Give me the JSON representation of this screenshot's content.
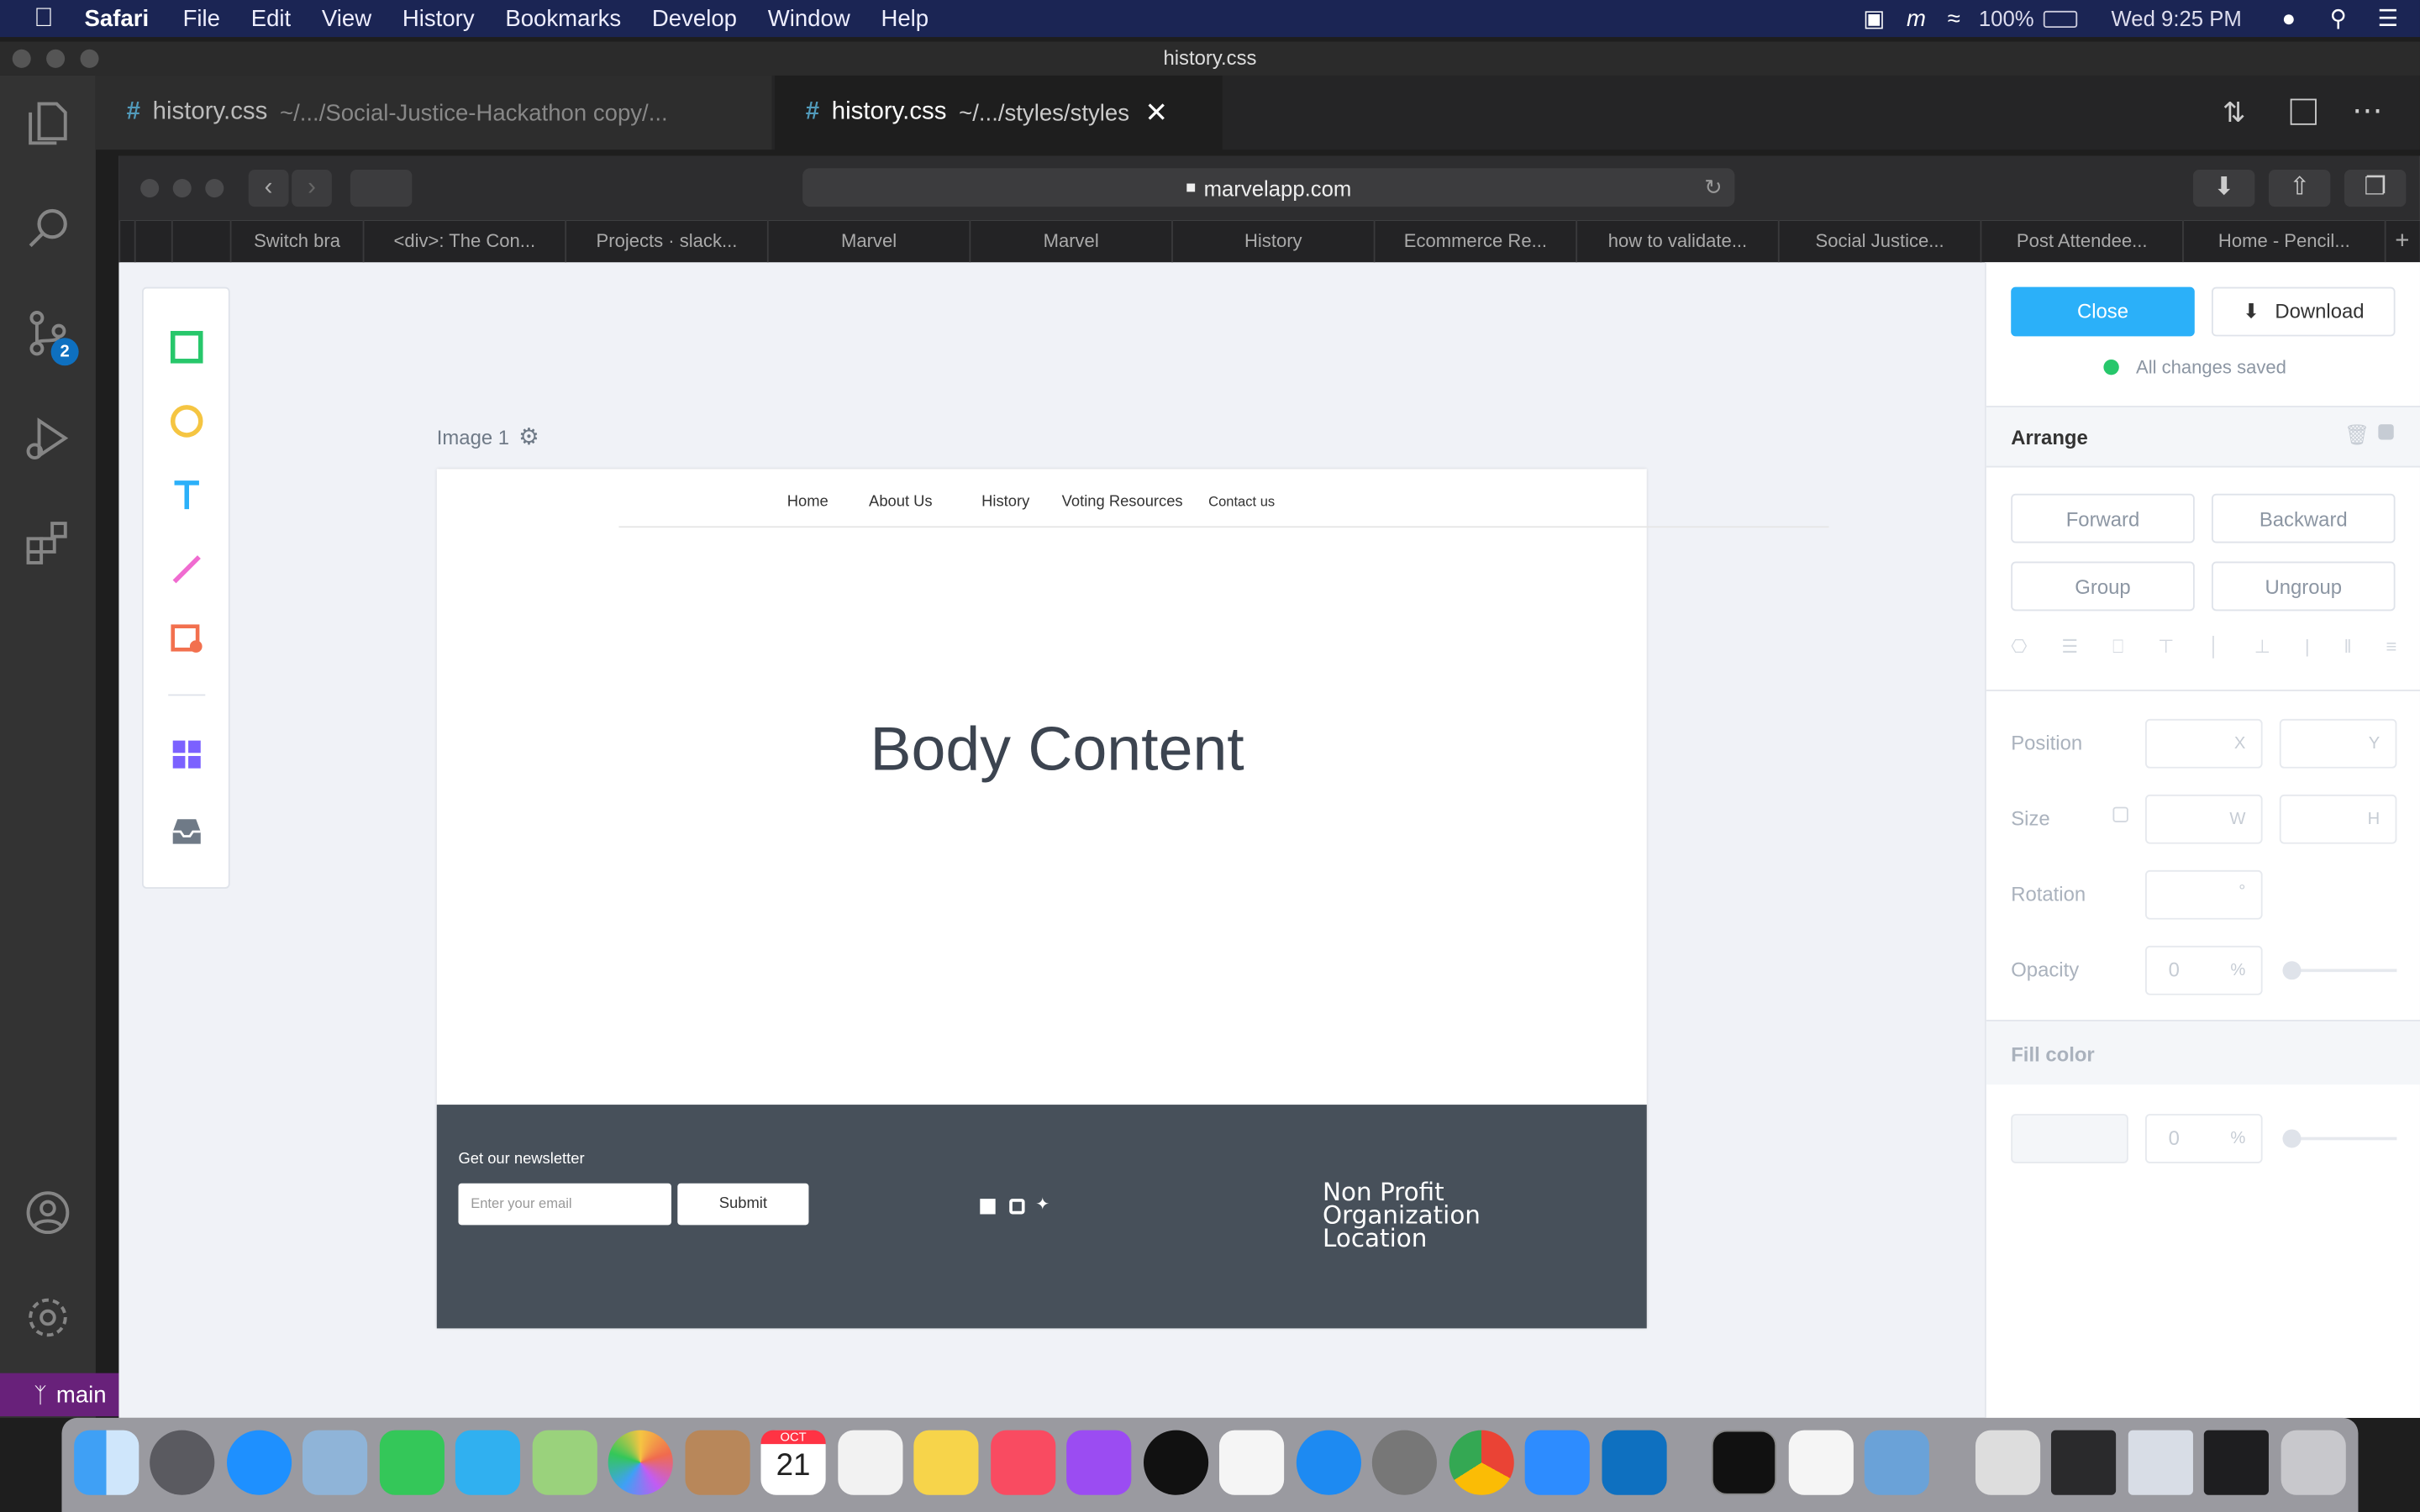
{
  "menubar": {
    "app": "Safari",
    "items": [
      "File",
      "Edit",
      "View",
      "History",
      "Bookmarks",
      "Develop",
      "Window",
      "Help"
    ],
    "battery": "100%",
    "clock": "Wed 9:25 PM"
  },
  "window": {
    "title": "history.css"
  },
  "editor_tabs": [
    {
      "name": "history.css",
      "path": "~/.../Social-Justice-Hackathon copy/..."
    },
    {
      "name": "history.css",
      "path": "~/.../styles/styles"
    }
  ],
  "activity": {
    "source_control_badge": "2"
  },
  "statusbar": {
    "branch": "main"
  },
  "safari": {
    "url": "marvelapp.com",
    "tabs": [
      "Switch bra",
      "<div>: The Con...",
      "Projects · slack...",
      "Marvel",
      "Marvel",
      "History",
      "Ecommerce Re...",
      "how to validate...",
      "Social Justice...",
      "Post Attendee...",
      "Home - Pencil..."
    ]
  },
  "canvas": {
    "image_label": "Image 1",
    "nav": [
      "Home",
      "About Us",
      "History",
      "Voting Resources",
      "Contact us"
    ],
    "body": "Body Content",
    "footer": {
      "newsletter_label": "Get our newsletter",
      "email_placeholder": "Enter your email",
      "submit": "Submit",
      "org_line1": "Non Profit",
      "org_line2": "Organization",
      "org_line3": "Location"
    }
  },
  "panel": {
    "close": "Close",
    "download": "Download",
    "saved": "All changes saved",
    "arrange": "Arrange",
    "forward": "Forward",
    "backward": "Backward",
    "group": "Group",
    "ungroup": "Ungroup",
    "position": "Position",
    "size": "Size",
    "rotation": "Rotation",
    "opacity": "Opacity",
    "x": "X",
    "y": "Y",
    "w": "W",
    "h": "H",
    "degree": "°",
    "opacity_value": "0",
    "percent": "%",
    "fill_color": "Fill color",
    "fill_opacity": "0"
  },
  "dock": {
    "calendar_month": "OCT",
    "calendar_day": "21"
  },
  "colors": {
    "accent": "#2bb0f9",
    "saved_dot": "#27c76b",
    "footer": "#47505a",
    "vscode_status": "#68217a"
  }
}
